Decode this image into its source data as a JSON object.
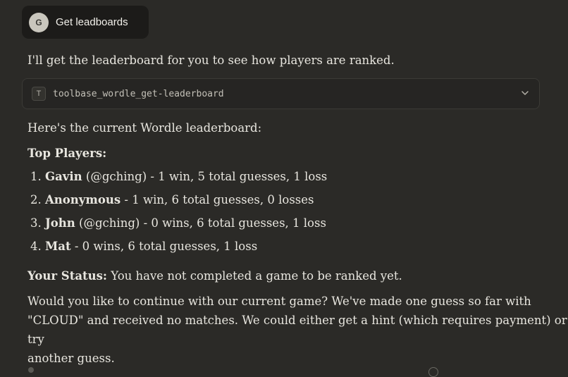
{
  "user_message": {
    "avatar_initial": "G",
    "text": "Get leadboards"
  },
  "assistant": {
    "intro": "I'll get the leaderboard for you to see how players are ranked.",
    "tool_call": {
      "icon_letter": "T",
      "name": "toolbase_wordle_get-leaderboard"
    },
    "summary": "Here's the current Wordle leaderboard:",
    "top_players_heading": "Top Players:",
    "players": [
      {
        "num": "1.",
        "name": "Gavin",
        "rest": " (@gching) - 1 win, 5 total guesses, 1 loss"
      },
      {
        "num": "2.",
        "name": "Anonymous",
        "rest": " - 1 win, 6 total guesses, 0 losses"
      },
      {
        "num": "3.",
        "name": "John",
        "rest": " (@gching) - 0 wins, 6 total guesses, 1 loss"
      },
      {
        "num": "4.",
        "name": "Mat",
        "rest": " - 0 wins, 6 total guesses, 1 loss"
      }
    ],
    "status_label": "Your Status:",
    "status_text": " You have not completed a game to be ranked yet.",
    "closing_line1": "Would you like to continue with our current game? We've made one guess so far with",
    "closing_line2": "\"CLOUD\" and received no matches. We could either get a hint (which requires payment) or try",
    "closing_line3": "another guess."
  }
}
